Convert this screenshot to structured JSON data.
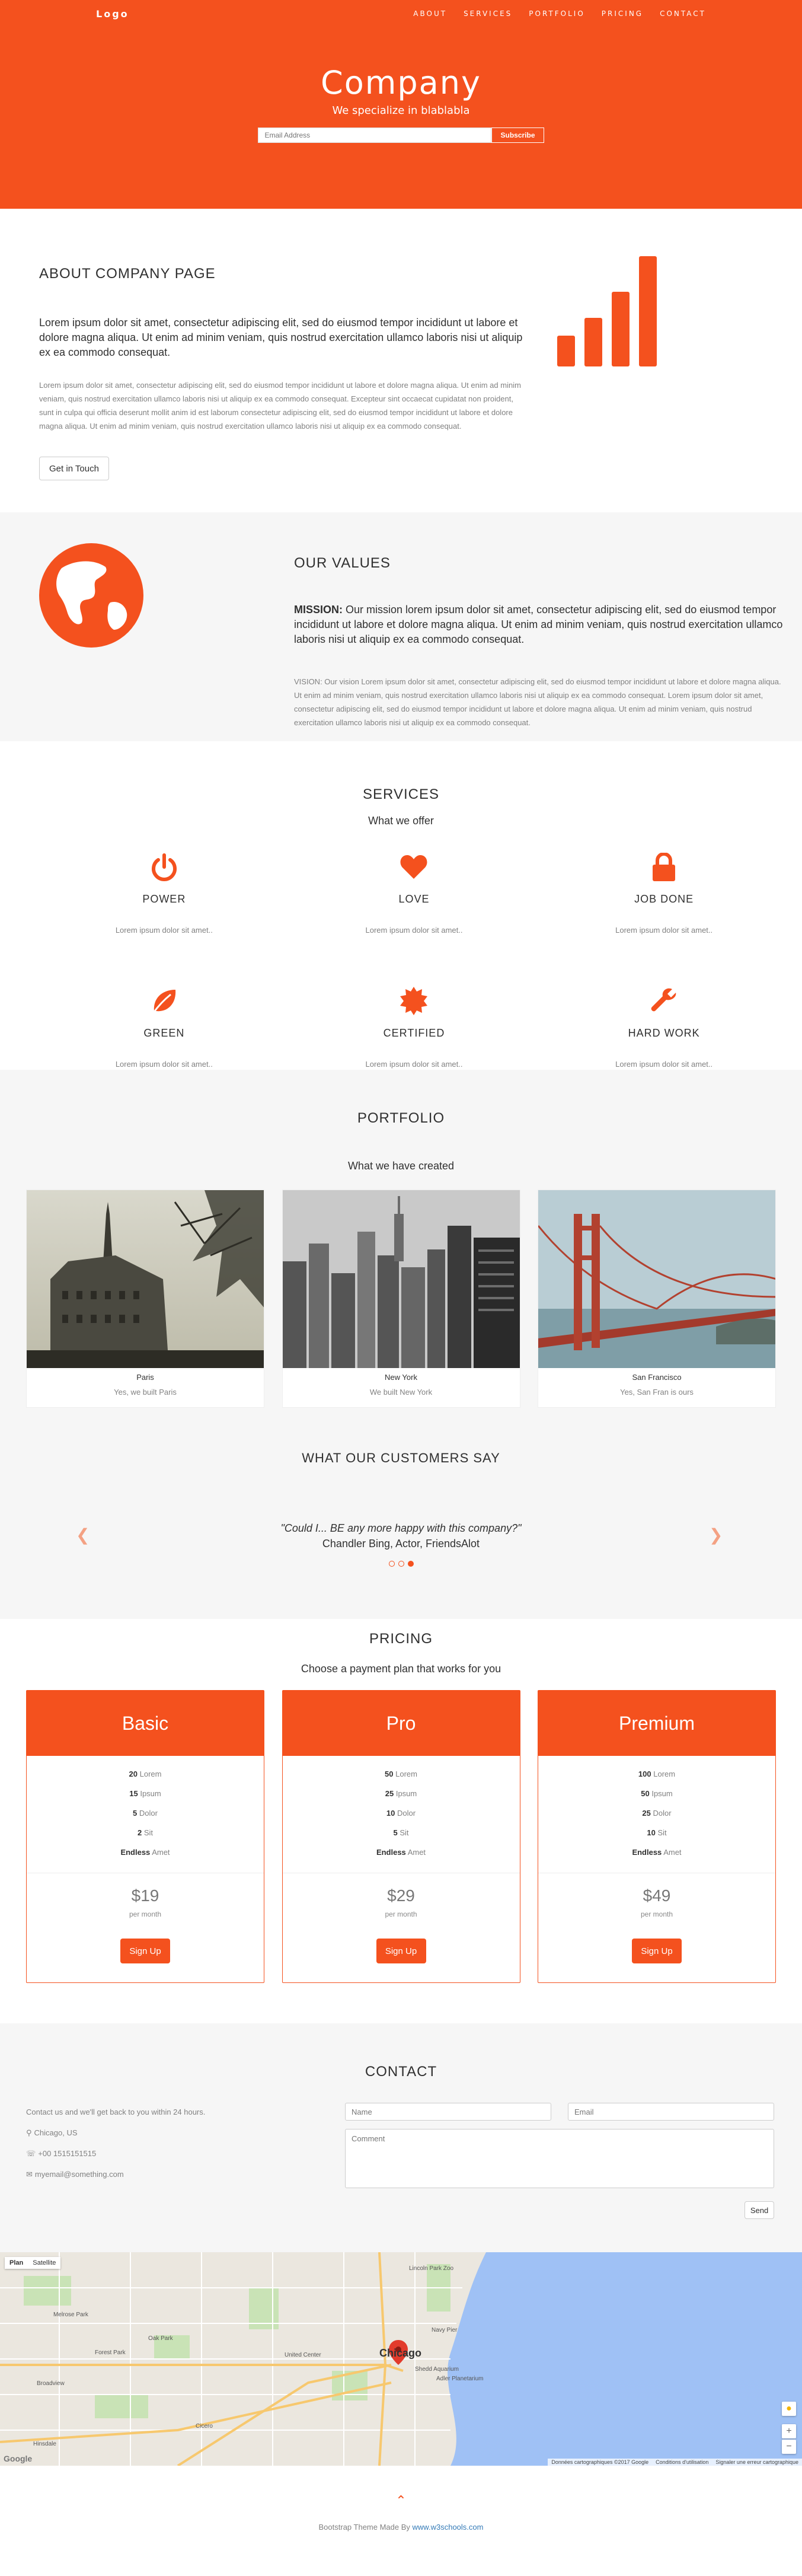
{
  "nav": {
    "logo": "Logo",
    "links": [
      "ABOUT",
      "SERVICES",
      "PORTFOLIO",
      "PRICING",
      "CONTACT"
    ]
  },
  "hero": {
    "title": "Company",
    "tagline": "We specialize in blablabla",
    "email_placeholder": "Email Address",
    "subscribe_label": "Subscribe"
  },
  "about": {
    "heading": "ABOUT COMPANY PAGE",
    "lead": "Lorem ipsum dolor sit amet, consectetur adipiscing elit, sed do eiusmod tempor incididunt ut labore et dolore magna aliqua. Ut enim ad minim veniam, quis nostrud exercitation ullamco laboris nisi ut aliquip ex ea commodo consequat.",
    "body": "Lorem ipsum dolor sit amet, consectetur adipiscing elit, sed do eiusmod tempor incididunt ut labore et dolore magna aliqua. Ut enim ad minim veniam, quis nostrud exercitation ullamco laboris nisi ut aliquip ex ea commodo consequat. Excepteur sint occaecat cupidatat non proident, sunt in culpa qui officia deserunt mollit anim id est laborum consectetur adipiscing elit, sed do eiusmod tempor incididunt ut labore et dolore magna aliqua. Ut enim ad minim veniam, quis nostrud exercitation ullamco laboris nisi ut aliquip ex ea commodo consequat.",
    "button_label": "Get in Touch",
    "icon": "signal-icon"
  },
  "values": {
    "heading": "OUR VALUES",
    "mission_label": "MISSION:",
    "mission_text": " Our mission lorem ipsum dolor sit amet, consectetur adipiscing elit, sed do eiusmod tempor incididunt ut labore et dolore magna aliqua. Ut enim ad minim veniam, quis nostrud exercitation ullamco laboris nisi ut aliquip ex ea commodo consequat.",
    "vision_label": "VISION:",
    "vision_text": " Our vision Lorem ipsum dolor sit amet, consectetur adipiscing elit, sed do eiusmod tempor incididunt ut labore et dolore magna aliqua. Ut enim ad minim veniam, quis nostrud exercitation ullamco laboris nisi ut aliquip ex ea commodo consequat. Lorem ipsum dolor sit amet, consectetur adipiscing elit, sed do eiusmod tempor incididunt ut labore et dolore magna aliqua. Ut enim ad minim veniam, quis nostrud exercitation ullamco laboris nisi ut aliquip ex ea commodo consequat.",
    "icon": "globe-icon"
  },
  "services": {
    "heading": "SERVICES",
    "subheading": "What we offer",
    "items": [
      {
        "title": "POWER",
        "desc": "Lorem ipsum dolor sit amet..",
        "icon": "power-icon"
      },
      {
        "title": "LOVE",
        "desc": "Lorem ipsum dolor sit amet..",
        "icon": "heart-icon"
      },
      {
        "title": "JOB DONE",
        "desc": "Lorem ipsum dolor sit amet..",
        "icon": "lock-icon"
      },
      {
        "title": "GREEN",
        "desc": "Lorem ipsum dolor sit amet..",
        "icon": "leaf-icon"
      },
      {
        "title": "CERTIFIED",
        "desc": "Lorem ipsum dolor sit amet..",
        "icon": "certificate-icon"
      },
      {
        "title": "HARD WORK",
        "desc": "Lorem ipsum dolor sit amet..",
        "icon": "wrench-icon"
      }
    ]
  },
  "portfolio": {
    "heading": "PORTFOLIO",
    "subheading": "What we have created",
    "items": [
      {
        "title": "Paris",
        "desc": "Yes, we built Paris"
      },
      {
        "title": "New York",
        "desc": "We built New York"
      },
      {
        "title": "San Francisco",
        "desc": "Yes, San Fran is ours"
      }
    ],
    "testimonial_heading": "WHAT OUR CUSTOMERS SAY",
    "quote": "\"Could I... BE any more happy with this company?\"",
    "author": "Chandler Bing, Actor, FriendsAlot",
    "active_slide": 3,
    "slide_count": 3
  },
  "pricing": {
    "heading": "PRICING",
    "subheading": "Choose a payment plan that works for you",
    "plans": [
      {
        "name": "Basic",
        "features": [
          [
            "20",
            "Lorem"
          ],
          [
            "15",
            "Ipsum"
          ],
          [
            "5",
            "Dolor"
          ],
          [
            "2",
            "Sit"
          ],
          [
            "Endless",
            "Amet"
          ]
        ],
        "price": "$19",
        "period": "per month",
        "button": "Sign Up"
      },
      {
        "name": "Pro",
        "features": [
          [
            "50",
            "Lorem"
          ],
          [
            "25",
            "Ipsum"
          ],
          [
            "10",
            "Dolor"
          ],
          [
            "5",
            "Sit"
          ],
          [
            "Endless",
            "Amet"
          ]
        ],
        "price": "$29",
        "period": "per month",
        "button": "Sign Up"
      },
      {
        "name": "Premium",
        "features": [
          [
            "100",
            "Lorem"
          ],
          [
            "50",
            "Ipsum"
          ],
          [
            "25",
            "Dolor"
          ],
          [
            "10",
            "Sit"
          ],
          [
            "Endless",
            "Amet"
          ]
        ],
        "price": "$49",
        "period": "per month",
        "button": "Sign Up"
      }
    ]
  },
  "contact": {
    "heading": "CONTACT",
    "intro": "Contact us and we'll get back to you within 24 hours.",
    "location": "Chicago, US",
    "phone": "+00 1515151515",
    "email": "myemail@something.com",
    "name_placeholder": "Name",
    "email_placeholder": "Email",
    "comment_placeholder": "Comment",
    "send_label": "Send"
  },
  "map": {
    "tab_map": "Plan",
    "tab_satellite": "Satellite",
    "city_label": "Chicago",
    "attribution": [
      "Données cartographiques ©2017 Google",
      "Conditions d'utilisation",
      "Signaler une erreur cartographique"
    ],
    "google_label": "Google",
    "place_labels": [
      "Lincoln Park Zoo",
      "Navy Pier",
      "United Center",
      "Shedd Aquarium",
      "Adler Planetarium",
      "Oak Park",
      "Cicero",
      "Forest Park",
      "Melrose Park",
      "Broadview",
      "Hinsdale"
    ]
  },
  "footer": {
    "text": "Bootstrap Theme Made By ",
    "link": "www.w3schools.com"
  },
  "colors": {
    "accent": "#f4511e",
    "light_bg": "#f6f6f6",
    "muted": "#818181"
  }
}
